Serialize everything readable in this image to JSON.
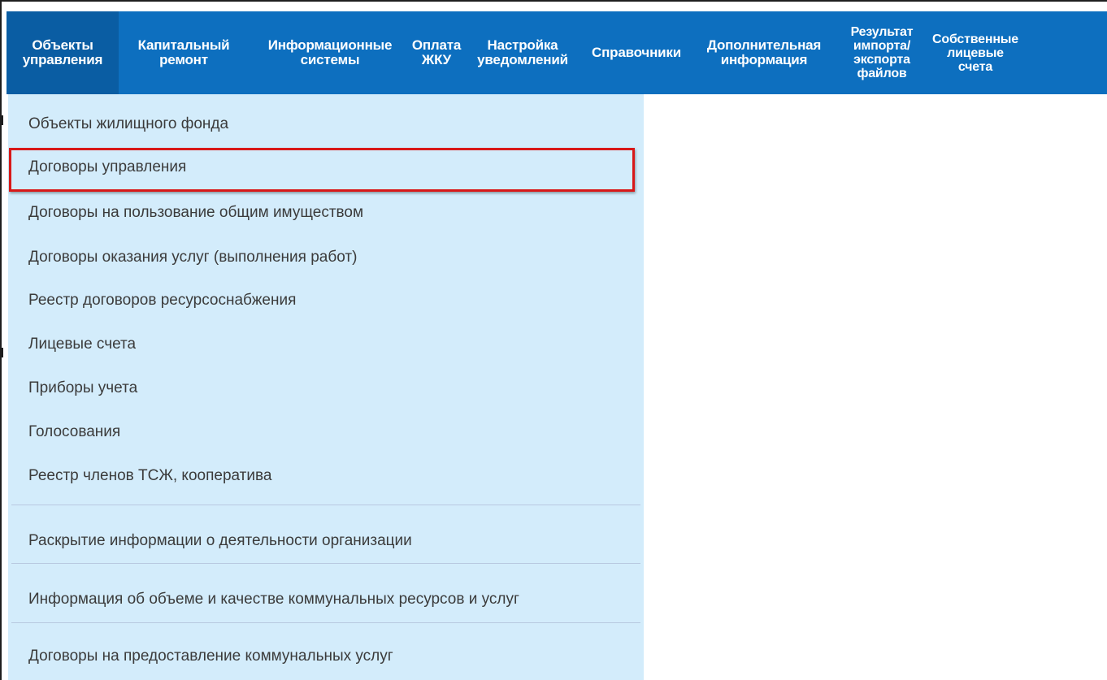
{
  "navbar": {
    "items": [
      {
        "label": "Объекты\nуправления"
      },
      {
        "label": "Капитальный\nремонт"
      },
      {
        "label": "Информационные\nсистемы"
      },
      {
        "label": "Оплата\nЖКУ"
      },
      {
        "label": "Настройка\nуведомлений"
      },
      {
        "label": "Справочники"
      },
      {
        "label": "Дополнительная\nинформация"
      },
      {
        "label": "Результат\nимпорта/\nэкспорта\nфайлов"
      },
      {
        "label": "Собственные\nлицевые\nсчета"
      }
    ],
    "colors": {
      "background": "#0d6fbf",
      "active": "#0a5da3",
      "text": "#ffffff"
    }
  },
  "dropdown": {
    "items": [
      {
        "label": "Объекты жилищного фонда"
      },
      {
        "label": "Договоры управления",
        "highlighted": true
      },
      {
        "label": "Договоры на пользование общим имуществом"
      },
      {
        "label": "Договоры оказания услуг (выполнения работ)"
      },
      {
        "label": "Реестр договоров ресурсоснабжения"
      },
      {
        "label": "Лицевые счета"
      },
      {
        "label": "Приборы учета"
      },
      {
        "label": "Голосования"
      },
      {
        "label": "Реестр членов ТСЖ, кооператива"
      },
      {
        "label": "Раскрытие информации о деятельности организации"
      },
      {
        "label": "Информация об объеме и качестве коммунальных ресурсов и услуг"
      },
      {
        "label": "Договоры на предоставление коммунальных услуг"
      }
    ],
    "colors": {
      "background": "#d3ecfb",
      "highlight_border": "#d81818",
      "text": "#3b3b3b"
    }
  }
}
